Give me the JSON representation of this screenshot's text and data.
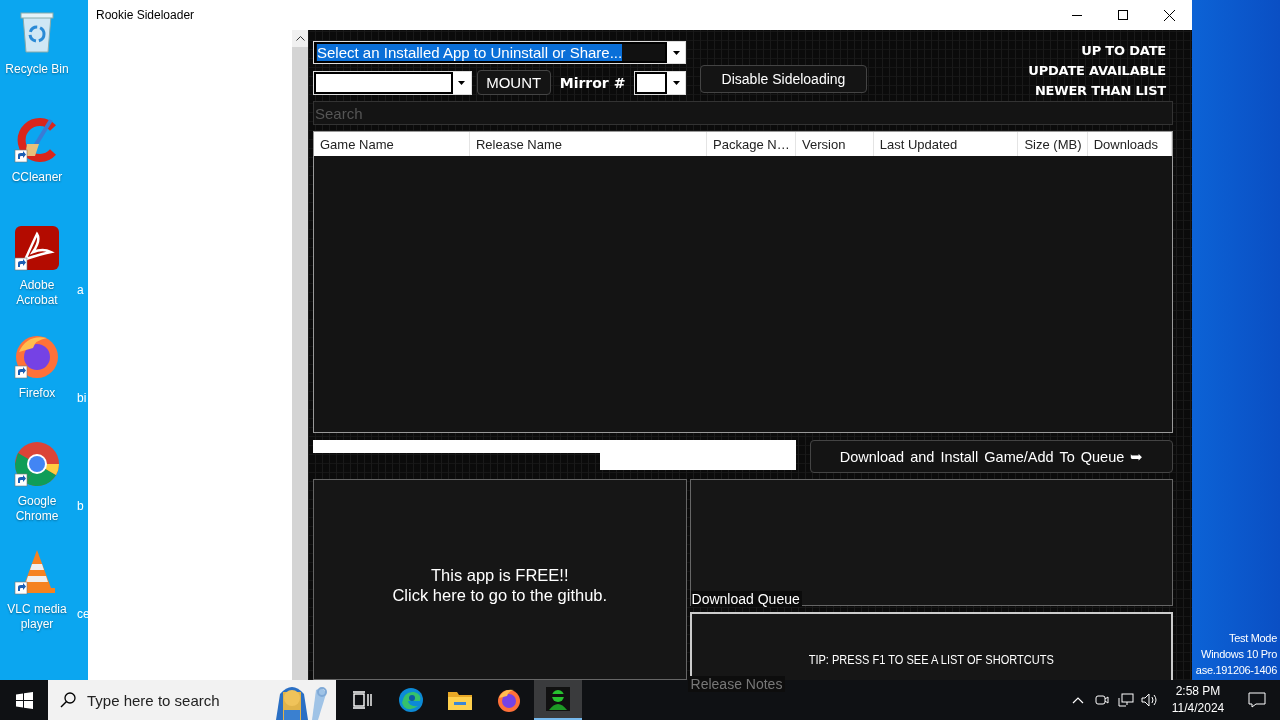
{
  "desktop": {
    "icons": [
      {
        "kind": "recycle",
        "label": "Recycle Bin"
      },
      {
        "kind": "ccleaner",
        "label": "CCleaner"
      },
      {
        "kind": "acrobat",
        "label": "Adobe Acrobat"
      },
      {
        "kind": "firefox",
        "label": "Firefox"
      },
      {
        "kind": "chrome",
        "label": "Google Chrome"
      },
      {
        "kind": "vlc",
        "label": "VLC media player"
      }
    ],
    "cut_labels": [
      "a",
      "bi",
      "b",
      "ce"
    ],
    "system_watermark": [
      "Test Mode",
      "Windows 10 Pro",
      "ase.191206-1406"
    ]
  },
  "window": {
    "title": "Rookie Sideloader"
  },
  "app": {
    "installed_apps_combo": {
      "value": "Select an Installed App to Uninstall or Share...",
      "highlighted": true
    },
    "mount_button": "MOUNT",
    "mirror_label": "Mirror #",
    "disable_button": "Disable Sideloading",
    "legend": [
      "UP TO DATE",
      "UPDATE AVAILABLE",
      "NEWER THAN LIST"
    ],
    "search": {
      "placeholder": "Search"
    },
    "table": {
      "columns": [
        "Game Name",
        "Release Name",
        "Package N…",
        "Version",
        "Last Updated",
        "Size (MB)",
        "Downloads"
      ]
    },
    "download_button": "Download and Install Game/Add To Queue ➥",
    "github_notice": [
      "This app is FREE!!",
      "Click here to go to the github."
    ],
    "download_queue": {
      "label": "Download Queue"
    },
    "release_notes": {
      "label": "Release Notes",
      "tip": "TIP: PRESS F1 TO SEE A LIST OF SHORTCUTS"
    }
  },
  "taskbar": {
    "search": {
      "placeholder": "Type here to search"
    },
    "apps": [
      {
        "kind": "task_view",
        "selected": false
      },
      {
        "kind": "edge",
        "selected": false
      },
      {
        "kind": "explorer",
        "selected": false
      },
      {
        "kind": "firefox",
        "selected": false
      },
      {
        "kind": "rookie",
        "selected": true
      }
    ],
    "clock": {
      "time": "2:58 PM",
      "date": "11/4/2024"
    }
  }
}
